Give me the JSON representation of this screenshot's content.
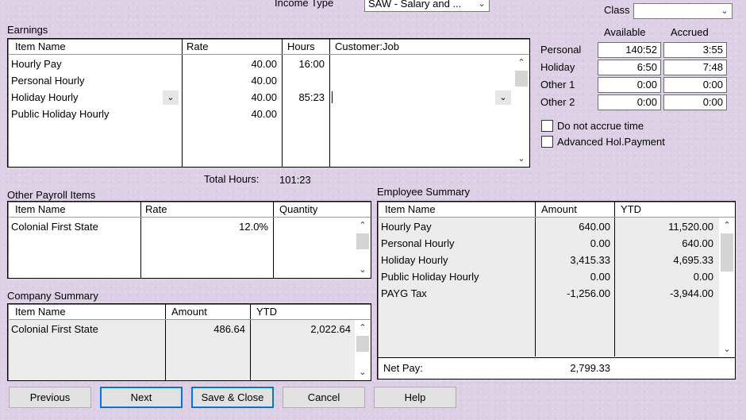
{
  "header": {
    "income_type_label": "Income Type",
    "income_type_value": "SAW - Salary and ...",
    "class_label": "Class",
    "class_value": ""
  },
  "earnings": {
    "title": "Earnings",
    "columns": [
      "Item Name",
      "Rate",
      "Hours",
      "Customer:Job"
    ],
    "rows": [
      {
        "item": "Hourly Pay",
        "rate": "40.00",
        "hours": "16:00",
        "job": ""
      },
      {
        "item": "Personal Hourly",
        "rate": "40.00",
        "hours": "",
        "job": ""
      },
      {
        "item": "Holiday Hourly",
        "rate": "40.00",
        "hours": "85:23",
        "job": ""
      },
      {
        "item": "Public Holiday Hourly",
        "rate": "40.00",
        "hours": "",
        "job": ""
      }
    ],
    "total_hours_label": "Total Hours:",
    "total_hours_value": "101:23"
  },
  "leave": {
    "available_header": "Available",
    "accrued_header": "Accrued",
    "rows": [
      {
        "label": "Personal",
        "available": "140:52",
        "accrued": "3:55"
      },
      {
        "label": "Holiday",
        "available": "6:50",
        "accrued": "7:48"
      },
      {
        "label": "Other 1",
        "available": "0:00",
        "accrued": "0:00"
      },
      {
        "label": "Other 2",
        "available": "0:00",
        "accrued": "0:00"
      }
    ],
    "do_not_accrue_label": "Do not accrue time",
    "advanced_hol_label": "Advanced Hol.Payment"
  },
  "other_payroll": {
    "title": "Other Payroll Items",
    "columns": [
      "Item Name",
      "Rate",
      "Quantity"
    ],
    "rows": [
      {
        "item": "Colonial First State",
        "rate": "12.0%",
        "quantity": ""
      }
    ]
  },
  "company_summary": {
    "title": "Company Summary",
    "columns": [
      "Item Name",
      "Amount",
      "YTD"
    ],
    "rows": [
      {
        "item": "Colonial First State",
        "amount": "486.64",
        "ytd": "2,022.64"
      }
    ]
  },
  "employee_summary": {
    "title": "Employee Summary",
    "columns": [
      "Item Name",
      "Amount",
      "YTD"
    ],
    "rows": [
      {
        "item": "Hourly Pay",
        "amount": "640.00",
        "ytd": "11,520.00"
      },
      {
        "item": "Personal Hourly",
        "amount": "0.00",
        "ytd": "640.00"
      },
      {
        "item": "Holiday Hourly",
        "amount": "3,415.33",
        "ytd": "4,695.33"
      },
      {
        "item": "Public Holiday Hourly",
        "amount": "0.00",
        "ytd": "0.00"
      },
      {
        "item": "PAYG Tax",
        "amount": "-1,256.00",
        "ytd": "-3,944.00"
      }
    ],
    "net_pay_label": "Net Pay:",
    "net_pay_value": "2,799.33"
  },
  "buttons": {
    "previous": "Previous",
    "next": "Next",
    "save_close": "Save & Close",
    "cancel": "Cancel",
    "help": "Help"
  }
}
